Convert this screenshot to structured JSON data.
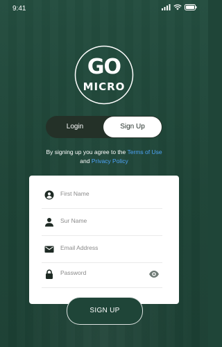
{
  "status_bar": {
    "time": "9:41",
    "icons": [
      "signal-icon",
      "wifi-icon",
      "battery-icon"
    ]
  },
  "logo": {
    "line1": "GO",
    "line2": "MICRO"
  },
  "toggle": {
    "login_label": "Login",
    "signup_label": "Sign Up",
    "selected": "Sign Up"
  },
  "terms": {
    "prefix": "By signing up you agree to the ",
    "terms_link": "Terms of Use",
    "middle": "and ",
    "privacy_link": "Privacy Policy"
  },
  "form": {
    "first_name_placeholder": "First Name",
    "sur_name_placeholder": "Sur Name",
    "email_placeholder": "Email Address",
    "password_placeholder": "Password"
  },
  "submit": {
    "label": "SIGN UP"
  },
  "colors": {
    "background": "#1f4538",
    "link": "#4da3f7",
    "card": "#ffffff",
    "icon": "#1e2a24"
  }
}
